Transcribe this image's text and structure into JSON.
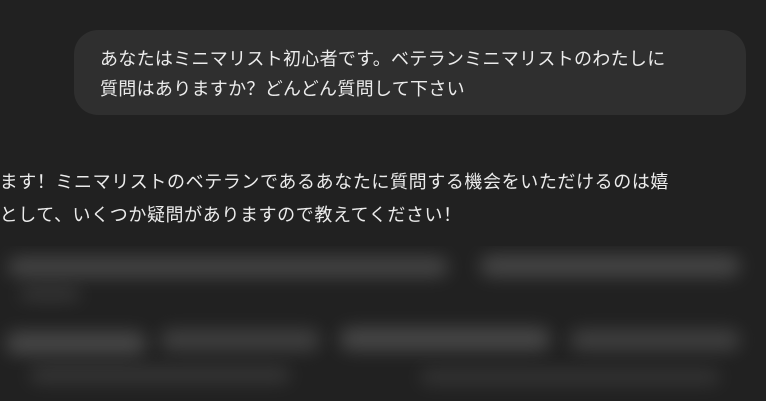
{
  "user_message": {
    "lines": [
      "あなたはミニマリスト初心者です。ベテランミニマリストのわたしに",
      "質問はありますか？どんどん質問して下さい"
    ]
  },
  "assistant_message": {
    "lines": [
      "います！ミニマリストのベテランであるあなたに質問する機会をいただけるのは嬉",
      "者として、いくつか疑問がありますので教えてください！"
    ]
  }
}
